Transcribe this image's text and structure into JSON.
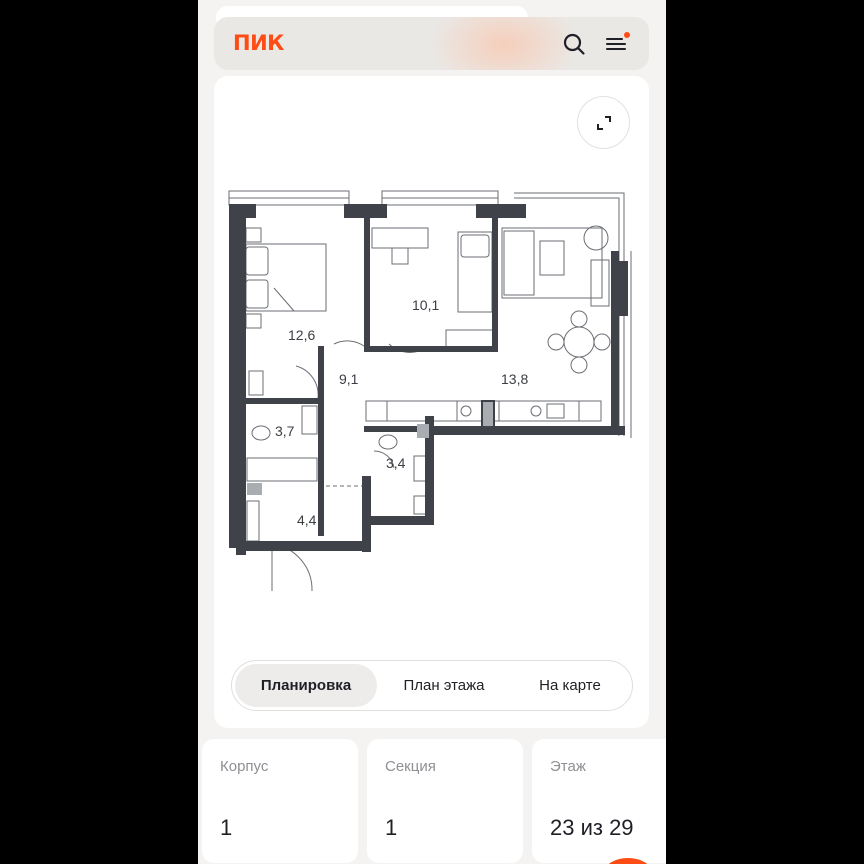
{
  "header": {
    "logo": "ПИК",
    "search_icon": "search-icon",
    "menu_icon": "menu-icon",
    "notification_color": "#ff4b14"
  },
  "plan": {
    "expand_icon": "expand-icon",
    "rooms": [
      {
        "id": "bedroom-1",
        "area": "12,6"
      },
      {
        "id": "bedroom-2",
        "area": "10,1"
      },
      {
        "id": "hall",
        "area": "9,1"
      },
      {
        "id": "kitchen-living",
        "area": "13,8"
      },
      {
        "id": "bathroom",
        "area": "3,7"
      },
      {
        "id": "toilet",
        "area": "3,4"
      },
      {
        "id": "entrance",
        "area": "4,4"
      }
    ]
  },
  "tabs": [
    {
      "label": "Планировка",
      "active": true
    },
    {
      "label": "План этажа",
      "active": false
    },
    {
      "label": "На карте",
      "active": false
    }
  ],
  "info": [
    {
      "label": "Корпус",
      "value": "1"
    },
    {
      "label": "Секция",
      "value": "1"
    },
    {
      "label": "Этаж",
      "value": "23 из 29"
    }
  ],
  "colors": {
    "brand": "#ff4b14",
    "wall": "#3f4249",
    "background": "#f4f3f1"
  }
}
